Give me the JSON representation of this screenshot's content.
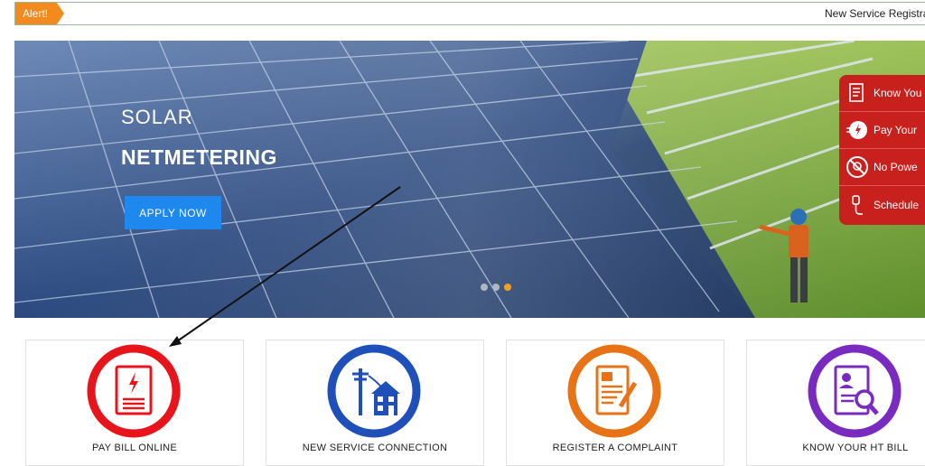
{
  "alert": {
    "tag": "Alert!",
    "ticker_text": "New Service Registra"
  },
  "hero": {
    "title_line1": "SOLAR",
    "title_line2": "NETMETERING",
    "cta_label": "APPLY NOW",
    "slide_count": 3,
    "active_slide": 3
  },
  "side_menu": {
    "items": [
      {
        "label": "Know You",
        "icon": "receipt-icon"
      },
      {
        "label": "Pay Your",
        "icon": "power-plug-icon"
      },
      {
        "label": "No Powe",
        "icon": "no-power-icon"
      },
      {
        "label": "Schedule",
        "icon": "schedule-plug-icon"
      }
    ]
  },
  "services": [
    {
      "label": "PAY BILL ONLINE",
      "icon": "bill-icon",
      "color": "#e8141b"
    },
    {
      "label": "NEW SERVICE CONNECTION",
      "icon": "house-pole-icon",
      "color": "#1f4fb8"
    },
    {
      "label": "REGISTER A COMPLAINT",
      "icon": "complaint-form-icon",
      "color": "#e87317"
    },
    {
      "label": "KNOW YOUR HT BILL",
      "icon": "document-search-icon",
      "color": "#7a2bbf"
    }
  ],
  "colors": {
    "alert_orange": "#f28a1d",
    "cta_blue": "#1e88ee",
    "side_menu_red": "#c8201d"
  }
}
